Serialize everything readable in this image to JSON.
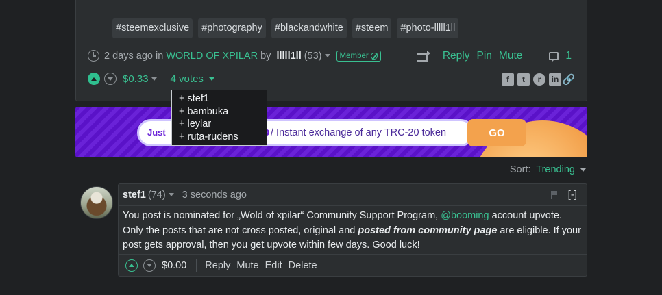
{
  "post": {
    "tags": [
      "#steemexclusive",
      "#photography",
      "#blackandwhite",
      "#steem",
      "#photo-lllll1ll"
    ],
    "time": "2 days ago",
    "in_label": "in",
    "community": "WORLD OF XPILAR",
    "by_label": "by",
    "author": "lllll1ll",
    "reputation": "(53)",
    "badge": "Member",
    "actions": {
      "reply": "Reply",
      "pin": "Pin",
      "mute": "Mute",
      "comments_count": "1"
    },
    "payout": "$0.33",
    "votes_label": "4 votes",
    "voters": [
      "+ stef1",
      "+ bambuka",
      "+ leylar",
      "+ ruta-rudens"
    ]
  },
  "banner": {
    "left_text": "Just",
    "p_glyph": "p",
    "text": "/ Instant exchange of any TRC-20 token",
    "button": "GO"
  },
  "sort": {
    "label": "Sort:",
    "value": "Trending"
  },
  "comment": {
    "author": "stef1",
    "reputation": "(74)",
    "time": "3 seconds ago",
    "collapse": "[-]",
    "body_1": "You post is nominated for „Wold of xpilar“ Community Support Program, ",
    "mention": "@booming",
    "body_2": " account upvote. Only the posts that are not cross posted, original and ",
    "body_bold": "posted from community page",
    "body_3": " are eligible. If your post gets approval, then you get upvote within few days. Good luck!",
    "payout": "$0.00",
    "actions": {
      "reply": "Reply",
      "mute": "Mute",
      "edit": "Edit",
      "delete": "Delete"
    }
  },
  "share": {
    "facebook": "f",
    "twitter": "t",
    "reddit": "r",
    "linkedin": "in",
    "link": "🔗"
  },
  "colors": {
    "accent": "#39c091",
    "background": "#1f2123",
    "card": "#2b2e30"
  }
}
